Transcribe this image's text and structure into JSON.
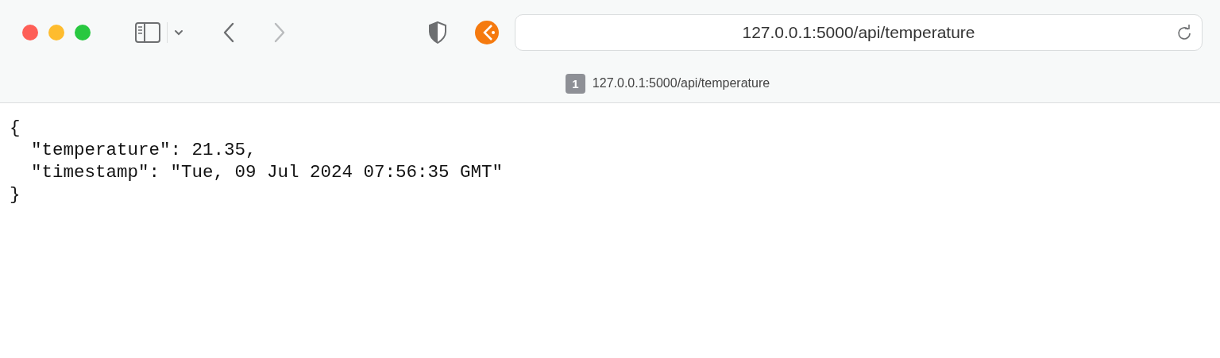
{
  "toolbar": {
    "back": {
      "disabled": false
    },
    "forward": {
      "disabled": true
    },
    "address": "127.0.0.1:5000/api/temperature"
  },
  "tab": {
    "badge": "1",
    "title": "127.0.0.1:5000/api/temperature"
  },
  "body": {
    "lines": [
      "{",
      "  \"temperature\": 21.35,",
      "  \"timestamp\": \"Tue, 09 Jul 2024 07:56:35 GMT\"",
      "}"
    ]
  }
}
